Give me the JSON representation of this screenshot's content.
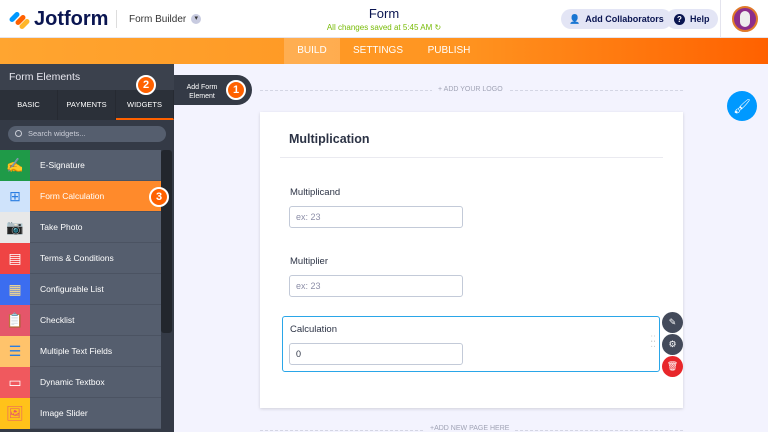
{
  "header": {
    "brand": "Jotform",
    "section": "Form Builder",
    "title": "Form",
    "saved_status": "All changes saved at 5:45 AM",
    "collaborators_label": "Add Collaborators",
    "help_label": "Help"
  },
  "nav": {
    "tabs": [
      "BUILD",
      "SETTINGS",
      "PUBLISH"
    ],
    "active": "BUILD"
  },
  "sidebar": {
    "title": "Form Elements",
    "tabs": [
      "BASIC",
      "PAYMENTS",
      "WIDGETS"
    ],
    "active_tab": "WIDGETS",
    "search_placeholder": "Search widgets...",
    "items": [
      {
        "label": "E-Signature",
        "color": "#1f9a48"
      },
      {
        "label": "Form Calculation",
        "color": "#cfe3fb"
      },
      {
        "label": "Take Photo",
        "color": "#e8e8e8"
      },
      {
        "label": "Terms & Conditions",
        "color": "#ef4444"
      },
      {
        "label": "Configurable List",
        "color": "#3b6df0"
      },
      {
        "label": "Checklist",
        "color": "#e5566a"
      },
      {
        "label": "Multiple Text Fields",
        "color": "#ffc36b"
      },
      {
        "label": "Dynamic Textbox",
        "color": "#f0595e"
      },
      {
        "label": "Image Slider",
        "color": "#ffc21a"
      }
    ],
    "selected": "Form Calculation"
  },
  "steps": [
    "1",
    "2",
    "3"
  ],
  "add_element_label": "Add Form Element",
  "canvas": {
    "add_logo": "+ ADD YOUR LOGO",
    "add_page": "+ADD NEW PAGE HERE"
  },
  "form": {
    "title": "Multiplication",
    "fields": [
      {
        "label": "Multiplicand",
        "placeholder": "ex: 23"
      },
      {
        "label": "Multiplier",
        "placeholder": "ex: 23"
      },
      {
        "label": "Calculation",
        "value": "0"
      }
    ]
  }
}
